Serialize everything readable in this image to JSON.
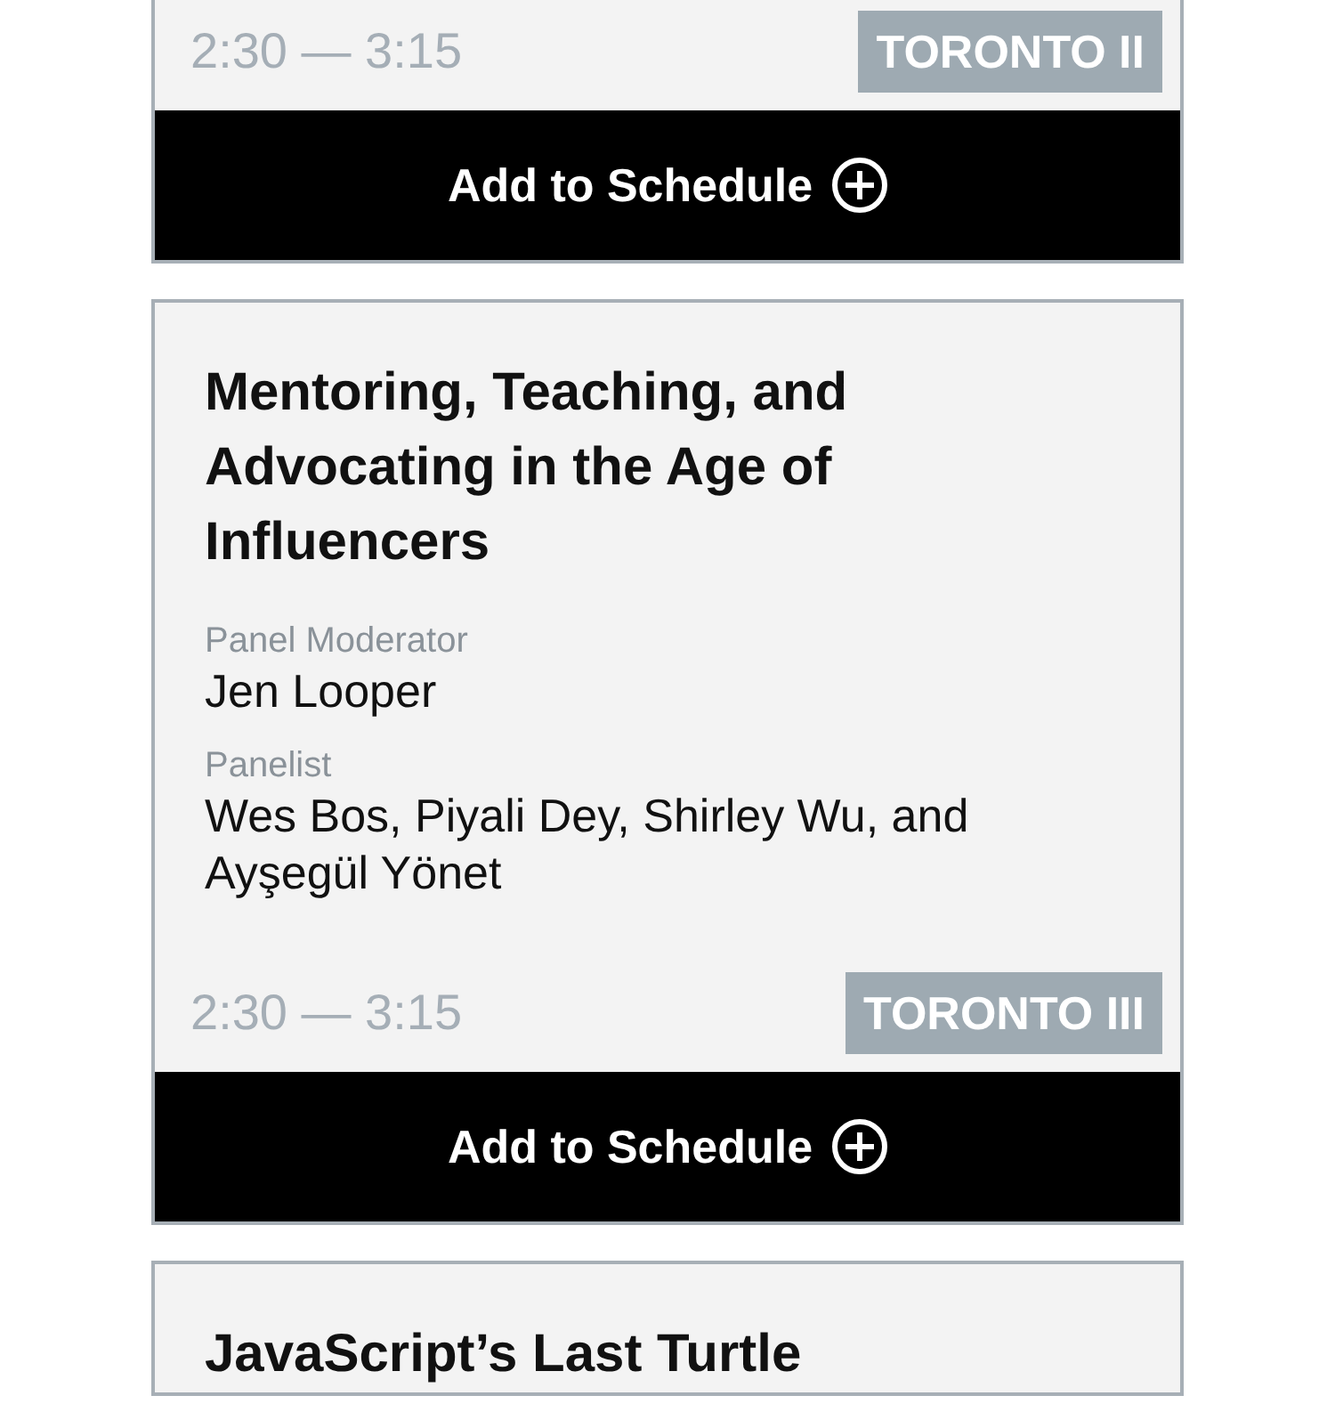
{
  "sessions": [
    {
      "time": "2:30 — 3:15",
      "room": "TORONTO II",
      "button": "Add to Schedule"
    },
    {
      "title": "Mentoring, Teaching, and Advocating in the Age of Influencers",
      "roles": [
        {
          "label": "Panel Moderator",
          "names": "Jen Looper"
        },
        {
          "label": "Panelist",
          "names": "Wes Bos, Piyali Dey, Shirley Wu, and Ayşegül Yönet"
        }
      ],
      "time": "2:30 — 3:15",
      "room": "TORONTO III",
      "button": "Add to Schedule"
    },
    {
      "title": "JavaScript’s Last Turtle"
    }
  ]
}
